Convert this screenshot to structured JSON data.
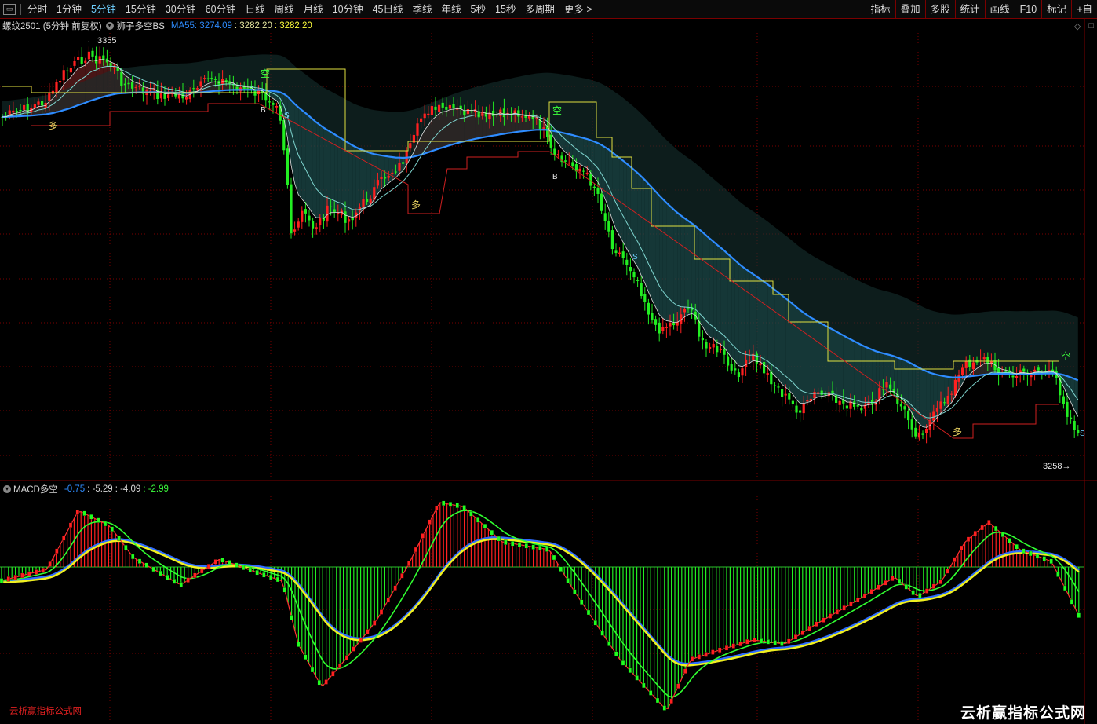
{
  "toolbar": {
    "periods": [
      "分时",
      "1分钟",
      "5分钟",
      "15分钟",
      "30分钟",
      "60分钟",
      "日线",
      "周线",
      "月线",
      "10分钟",
      "45日线",
      "季线",
      "年线",
      "5秒",
      "15秒",
      "多周期",
      "更多 >"
    ],
    "active_period": "5分钟",
    "right_buttons": [
      "指标",
      "叠加",
      "多股",
      "统计",
      "画线",
      "F10",
      "标记",
      "+自"
    ]
  },
  "price_pane": {
    "symbol": "螺纹2501 (5分钟 前复权)",
    "indicator": "狮子多空BS",
    "ma_label": "MA55: 3274.09",
    "value_1": ": 3282.20",
    "value_2": ": 3282.20",
    "high_marker": "3355",
    "low_marker": "3258",
    "signals": {
      "duo": "多",
      "kong": "空",
      "buy": "B",
      "sell": "S"
    }
  },
  "macd_pane": {
    "name": "MACD多空",
    "values": [
      "-0.75",
      ": -5.29",
      ": -4.09",
      ": -2.99"
    ]
  },
  "watermark": {
    "left": "云析赢指标公式网",
    "right": "云析赢指标公式网"
  },
  "colors": {
    "up": "#ff2020",
    "down": "#22ee22",
    "ma55": "#2e8cff",
    "stop_line": "#e0e040",
    "grid": "#7a0000"
  }
}
